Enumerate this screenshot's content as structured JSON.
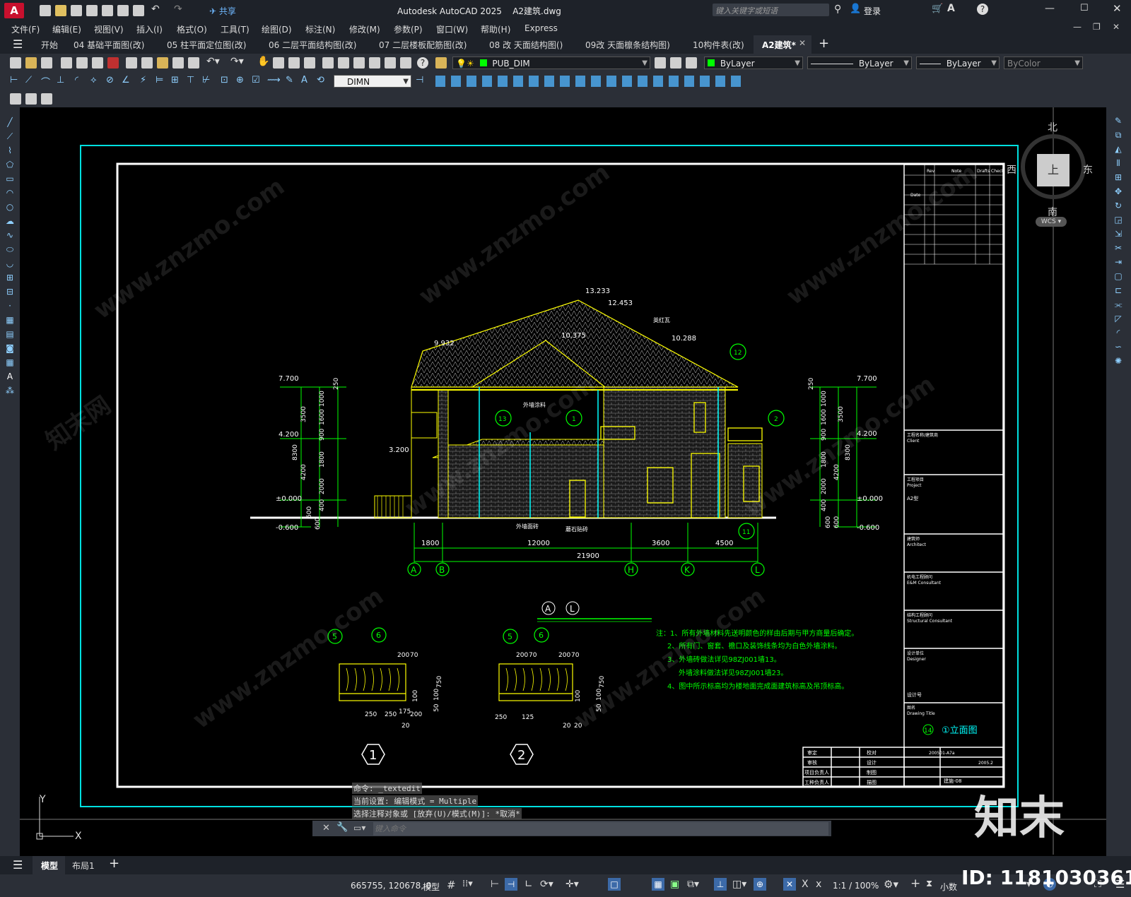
{
  "app": {
    "title": "Autodesk AutoCAD 2025",
    "file": "A2建筑.dwg",
    "share_label": "共享",
    "search_placeholder": "键入关键字或短语",
    "login_label": "登录"
  },
  "menu": [
    "文件(F)",
    "编辑(E)",
    "视图(V)",
    "插入(I)",
    "格式(O)",
    "工具(T)",
    "绘图(D)",
    "标注(N)",
    "修改(M)",
    "参数(P)",
    "窗口(W)",
    "帮助(H)",
    "Express"
  ],
  "tabs": [
    {
      "label": "开始"
    },
    {
      "label": "04 基础平面图(改)"
    },
    {
      "label": "05 柱平面定位图(改)"
    },
    {
      "label": "06 二层平面结构图(改)"
    },
    {
      "label": "07 二层楼板配筋图(改)"
    },
    {
      "label": "08 改 天面结构图()"
    },
    {
      "label": "09改 天面檩条结构图)"
    },
    {
      "label": "10构件表(改)"
    },
    {
      "label": "A2建筑*"
    }
  ],
  "properties": {
    "layer": "PUB_DIM",
    "color": "ByLayer",
    "linetype": "ByLayer",
    "lineweight": "ByLayer",
    "plotstyle": "ByColor",
    "dimstyle": "DIMN"
  },
  "viewcube": {
    "north": "北",
    "south": "南",
    "east": "东",
    "west": "西",
    "top": "上",
    "wcs": "WCS"
  },
  "drawing": {
    "elev_levels_left": [
      "7.700",
      "4.200",
      "3.200",
      "±0.000",
      "-0.600"
    ],
    "elev_levels_right": [
      "7.700",
      "4.200",
      "±0.000",
      "-0.600"
    ],
    "roof_levels": [
      "13.233",
      "12.453",
      "10.375",
      "10.288",
      "9.932"
    ],
    "roof_note": "英红瓦",
    "dims_left": [
      "1000",
      "1600",
      "3500",
      "900",
      "1800",
      "4200",
      "8300",
      "2000",
      "400",
      "600",
      "600",
      "250"
    ],
    "dims_bottom": [
      "1800",
      "12000",
      "3600",
      "4500"
    ],
    "dim_total": "21900",
    "grid_axes": [
      "A",
      "B",
      "H",
      "K",
      "L"
    ],
    "callouts": [
      "13",
      "1",
      "2",
      "12",
      "11"
    ],
    "labels_wall": [
      "外墙涂料",
      "外墙面砖",
      "蘑石贴砖"
    ],
    "view_title_axes": [
      "A",
      "L"
    ],
    "detail_markers": [
      "1",
      "2"
    ],
    "detail_callouts": [
      "5",
      "6"
    ],
    "detail1_dims": [
      "200",
      "70",
      "250",
      "250",
      "175",
      "200",
      "20",
      "750",
      "100",
      "50",
      "100"
    ],
    "detail2_dims": [
      "200",
      "70",
      "200",
      "70",
      "250",
      "125",
      "20",
      "20",
      "750",
      "100",
      "50",
      "100"
    ],
    "notes": [
      "注：1、所有外墙材料先送明颜色的样由后期与甲方商量后确定。",
      "2、所有门、窗套、檐口及装饰线条均为白色外墙涂料。",
      "3、外墙砖做法详见98ZJ001墙13。",
      "外墙涂料做法详见98ZJ001墙23。",
      "4、图中所示标高均为楼地面完成面建筑标高及吊顶标高。"
    ]
  },
  "titleblock": {
    "hdr": [
      "Rev",
      "Note",
      "Drafts",
      "Check"
    ],
    "date_label": "Date",
    "sections": [
      {
        "cn": "工程名称/建筑商",
        "en": "Client"
      },
      {
        "cn": "工程项目",
        "en": "Project",
        "value": "A2型"
      },
      {
        "cn": "建筑师",
        "en": "Architect"
      },
      {
        "cn": "机电工程顾问",
        "en": "E&M Consultant"
      },
      {
        "cn": "结构工程顾问",
        "en": "Structural Consultant"
      },
      {
        "cn": "设计单位",
        "en": "Designer",
        "value": "设计号"
      },
      {
        "cn": "图名",
        "en": "Drawing Title"
      }
    ],
    "drawing_title_num": "14",
    "drawing_title": "①立面图",
    "sign_rows": [
      [
        "审定",
        "校对"
      ],
      [
        "审核",
        "设计"
      ],
      [
        "项目负责人",
        "制图"
      ],
      [
        "工种负责人",
        "描图"
      ]
    ],
    "proj_no": "200501-A7a",
    "date": "2005.2",
    "drawing_no": "建施-08"
  },
  "command": {
    "lines": [
      "命令: _textedit",
      "当前设置: 编辑模式 = Multiple",
      "选择注释对象或 [放弃(U)/模式(M)]: *取消*"
    ],
    "placeholder": "键入命令"
  },
  "ucs": {
    "x": "X",
    "y": "Y"
  },
  "layout_tabs": [
    "模型",
    "布局1"
  ],
  "status": {
    "coords": "665755, 120678, 0",
    "model": "模型",
    "scale": "1:1 / 100%",
    "units": "小数"
  },
  "watermark": {
    "site": "www.znzmo.com",
    "brand": "知末网",
    "logo": "知末",
    "id": "ID: 1181030361"
  },
  "colors": {
    "accent": "#00ff00",
    "cyan": "#00ffff",
    "yellow": "#ffff00",
    "bg": "#000000",
    "ui": "#2b2f37"
  }
}
